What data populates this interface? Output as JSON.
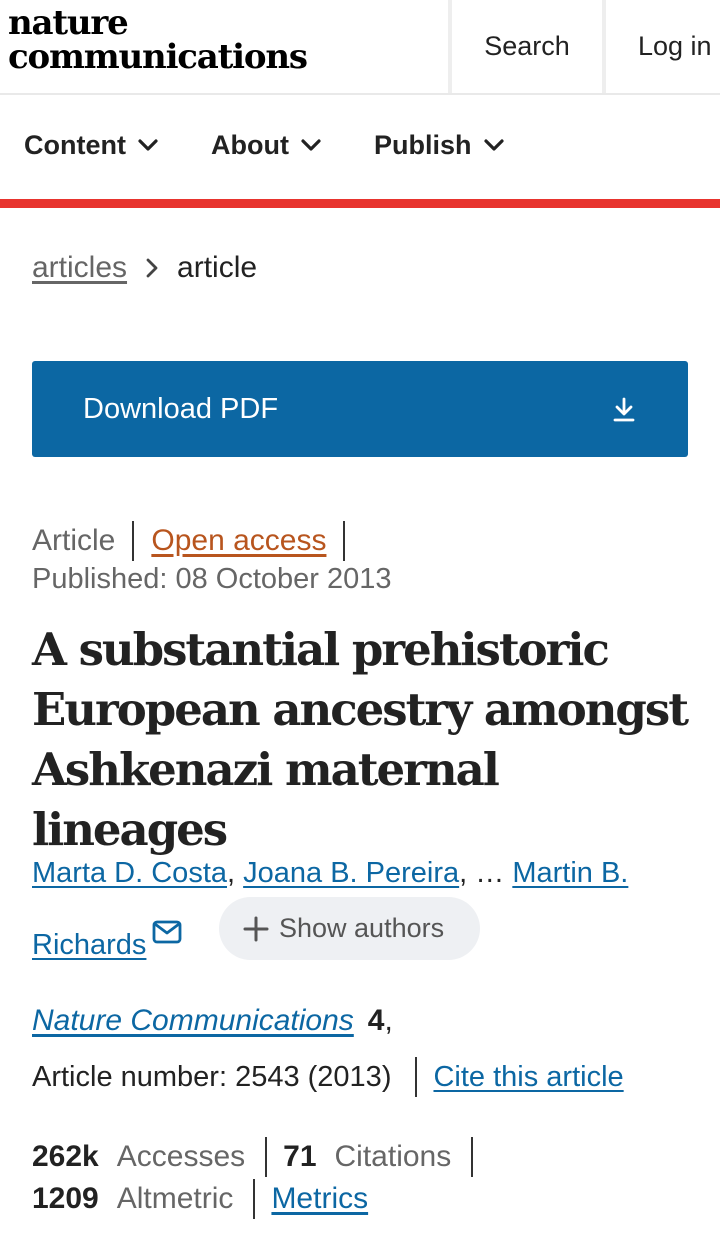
{
  "header": {
    "logo_line1": "nature",
    "logo_line2": "communications",
    "search_label": "Search",
    "login_label": "Log in"
  },
  "nav": {
    "items": [
      {
        "label": "Content"
      },
      {
        "label": "About"
      },
      {
        "label": "Publish"
      }
    ]
  },
  "breadcrumb": {
    "link": "articles",
    "current": "article"
  },
  "download": {
    "label": "Download PDF"
  },
  "article": {
    "type": "Article",
    "access": "Open access",
    "published": "Published: 08 October 2013",
    "title": "A substantial prehistoric European ancestry amongst Ashkenazi maternal lineages",
    "authors": [
      "Marta D. Costa",
      "Joana B. Pereira",
      "Martin B. Richards"
    ],
    "author_sep": ",",
    "ellipsis": "…",
    "show_authors": "Show authors",
    "journal": "Nature Communications",
    "volume": "4",
    "volume_comma": ",",
    "article_number": "Article number: 2543 (2013)",
    "cite": "Cite this article"
  },
  "metrics": {
    "accesses_value": "262k",
    "accesses_label": "Accesses",
    "citations_value": "71",
    "citations_label": "Citations",
    "altmetric_value": "1209",
    "altmetric_label": "Altmetric",
    "metrics_link": "Metrics"
  },
  "colors": {
    "accent_red": "#e8342e",
    "link_blue": "#0c67a3",
    "open_access_orange": "#b8551e"
  }
}
